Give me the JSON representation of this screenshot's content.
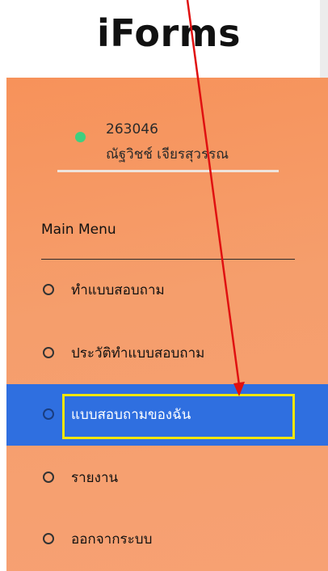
{
  "header": {
    "app_title": "iForms"
  },
  "user": {
    "id": "263046",
    "name": "ณัฐวิชช์ เจียรสุวรรณ",
    "status_color": "#3fcf7f"
  },
  "menu": {
    "heading": "Main Menu",
    "items": [
      {
        "label": "ทำแบบสอบถาม",
        "active": false
      },
      {
        "label": "ประวัติทำแบบสอบถาม",
        "active": false
      },
      {
        "label": "แบบสอบถามของฉัน",
        "active": true
      },
      {
        "label": "รายงาน",
        "active": false
      },
      {
        "label": "ออกจากระบบ",
        "active": false
      }
    ]
  },
  "colors": {
    "sidebar_bg": "#f7925a",
    "active_bg": "#2f6fe0",
    "highlight": "#f3e600",
    "annotation_arrow": "#e01010"
  }
}
